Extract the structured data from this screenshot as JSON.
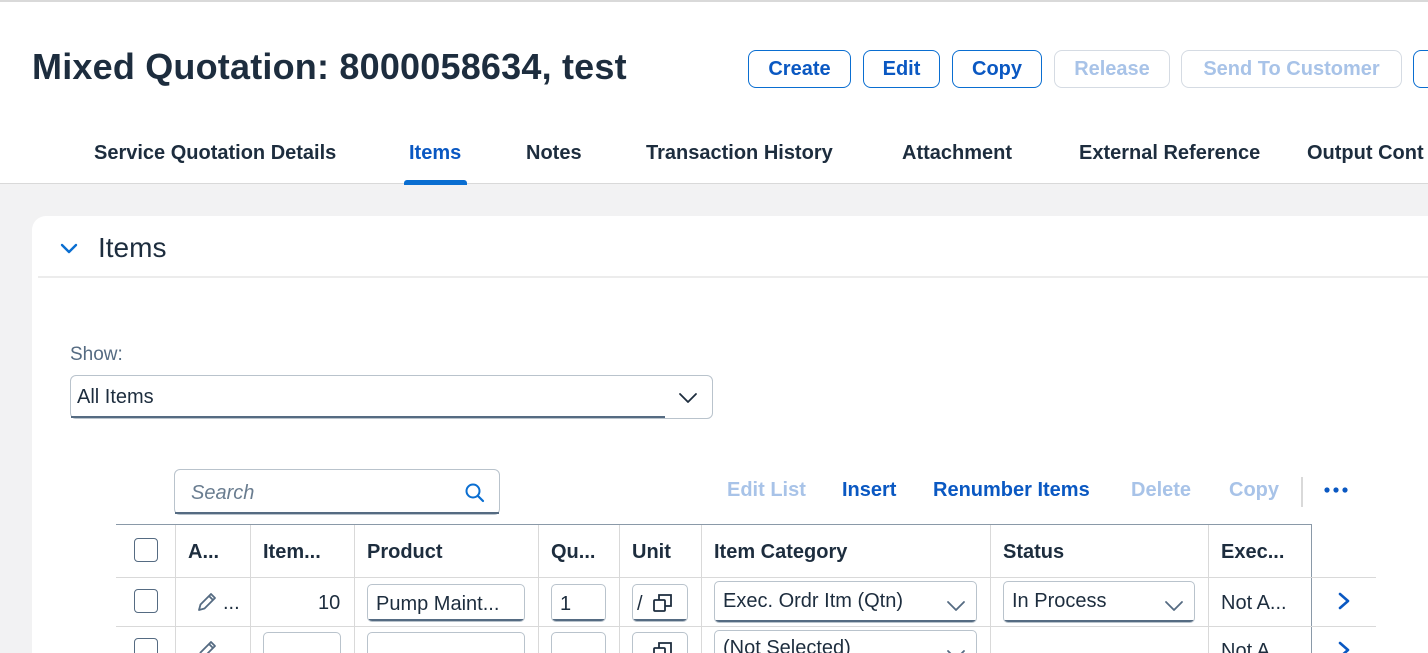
{
  "header": {
    "title": "Mixed Quotation: 8000058634, test",
    "actions": {
      "create": "Create",
      "edit": "Edit",
      "copy": "Copy",
      "release": "Release",
      "send_to_customer": "Send To Customer"
    }
  },
  "tabs": [
    {
      "label": "Service Quotation Details"
    },
    {
      "label": "Items"
    },
    {
      "label": "Notes"
    },
    {
      "label": "Transaction History"
    },
    {
      "label": "Attachment"
    },
    {
      "label": "External Reference"
    },
    {
      "label": "Output Cont"
    }
  ],
  "active_tab": "Items",
  "section": {
    "title": "Items",
    "show_label": "Show:",
    "show_value": "All Items"
  },
  "table_toolbar": {
    "search_placeholder": "Search",
    "edit_list": "Edit List",
    "insert": "Insert",
    "renumber_items": "Renumber Items",
    "delete": "Delete",
    "copy": "Copy"
  },
  "table": {
    "columns": [
      "A...",
      "Item...",
      "Product",
      "Qu...",
      "Unit",
      "Item Category",
      "Status",
      "Exec..."
    ],
    "rows": [
      {
        "action_more": "...",
        "item": "10",
        "product": "Pump Maint...",
        "quantity": "1",
        "unit": "/",
        "item_category": "Exec. Ordr Itm (Qtn)",
        "status": "In Process",
        "exec": "Not A..."
      },
      {
        "action_more": "",
        "item": "",
        "product": "",
        "quantity": "",
        "unit": "",
        "item_category": "(Not Selected)",
        "status": "",
        "exec": "Not A..."
      }
    ]
  },
  "colors": {
    "accent": "#0a6ed1",
    "link": "#0a58c2",
    "disabled": "#a8c3e8",
    "text": "#1d2d3e"
  }
}
